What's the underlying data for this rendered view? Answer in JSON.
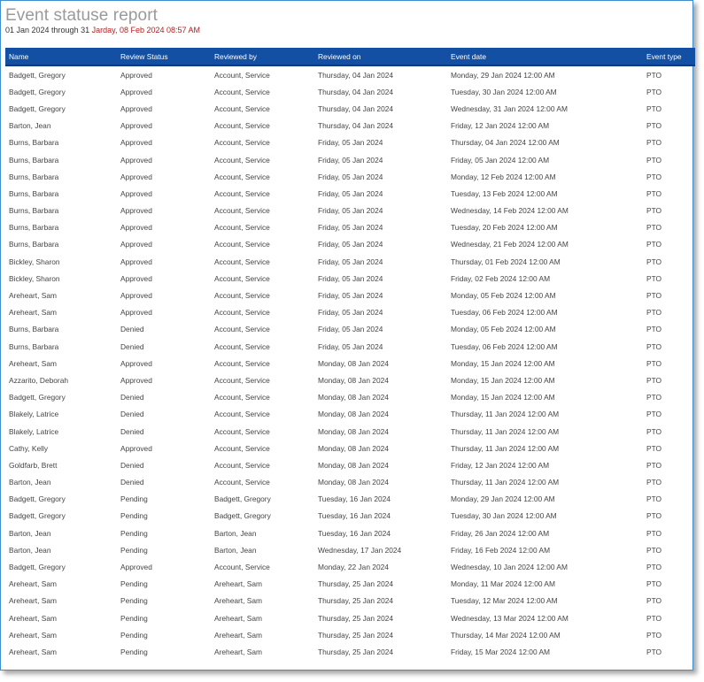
{
  "report": {
    "title": "Event statuse report",
    "range_start": "01 Jan 2024 through 31",
    "range_accent": "Jarday, 08 Feb 2024 08:57 AM"
  },
  "table": {
    "headers": [
      "Name",
      "Review Status",
      "Reviewed by",
      "Reviewed on",
      "Event date",
      "Event type"
    ],
    "rows": [
      [
        "Badgett, Gregory",
        "Approved",
        "Account, Service",
        "Thursday, 04 Jan 2024",
        "Monday, 29 Jan 2024 12:00 AM",
        "PTO"
      ],
      [
        "Badgett, Gregory",
        "Approved",
        "Account, Service",
        "Thursday, 04 Jan 2024",
        "Tuesday, 30 Jan 2024 12:00 AM",
        "PTO"
      ],
      [
        "Badgett, Gregory",
        "Approved",
        "Account, Service",
        "Thursday, 04 Jan 2024",
        "Wednesday, 31 Jan 2024 12:00 AM",
        "PTO"
      ],
      [
        "Barton, Jean",
        "Approved",
        "Account, Service",
        "Thursday, 04 Jan 2024",
        "Friday, 12 Jan 2024 12:00 AM",
        "PTO"
      ],
      [
        "Burns, Barbara",
        "Approved",
        "Account, Service",
        "Friday, 05 Jan 2024",
        "Thursday, 04 Jan 2024 12:00 AM",
        "PTO"
      ],
      [
        "Burns, Barbara",
        "Approved",
        "Account, Service",
        "Friday, 05 Jan 2024",
        "Friday, 05 Jan 2024 12:00 AM",
        "PTO"
      ],
      [
        "Burns, Barbara",
        "Approved",
        "Account, Service",
        "Friday, 05 Jan 2024",
        "Monday, 12 Feb 2024 12:00 AM",
        "PTO"
      ],
      [
        "Burns, Barbara",
        "Approved",
        "Account, Service",
        "Friday, 05 Jan 2024",
        "Tuesday, 13 Feb 2024 12:00 AM",
        "PTO"
      ],
      [
        "Burns, Barbara",
        "Approved",
        "Account, Service",
        "Friday, 05 Jan 2024",
        "Wednesday, 14 Feb 2024 12:00 AM",
        "PTO"
      ],
      [
        "Burns, Barbara",
        "Approved",
        "Account, Service",
        "Friday, 05 Jan 2024",
        "Tuesday, 20 Feb 2024 12:00 AM",
        "PTO"
      ],
      [
        "Burns, Barbara",
        "Approved",
        "Account, Service",
        "Friday, 05 Jan 2024",
        "Wednesday, 21 Feb 2024 12:00 AM",
        "PTO"
      ],
      [
        "Bickley, Sharon",
        "Approved",
        "Account, Service",
        "Friday, 05 Jan 2024",
        "Thursday, 01 Feb 2024 12:00 AM",
        "PTO"
      ],
      [
        "Bickley, Sharon",
        "Approved",
        "Account, Service",
        "Friday, 05 Jan 2024",
        "Friday, 02 Feb 2024 12:00 AM",
        "PTO"
      ],
      [
        "Areheart, Sam",
        "Approved",
        "Account, Service",
        "Friday, 05 Jan 2024",
        "Monday, 05 Feb 2024 12:00 AM",
        "PTO"
      ],
      [
        "Areheart, Sam",
        "Approved",
        "Account, Service",
        "Friday, 05 Jan 2024",
        "Tuesday, 06 Feb 2024 12:00 AM",
        "PTO"
      ],
      [
        "Burns, Barbara",
        "Denied",
        "Account, Service",
        "Friday, 05 Jan 2024",
        "Monday, 05 Feb 2024 12:00 AM",
        "PTO"
      ],
      [
        "Burns, Barbara",
        "Denied",
        "Account, Service",
        "Friday, 05 Jan 2024",
        "Tuesday, 06 Feb 2024 12:00 AM",
        "PTO"
      ],
      [
        "Areheart, Sam",
        "Approved",
        "Account, Service",
        "Monday, 08 Jan 2024",
        "Monday, 15 Jan 2024 12:00 AM",
        "PTO"
      ],
      [
        "Azzarito, Deborah",
        "Approved",
        "Account, Service",
        "Monday, 08 Jan 2024",
        "Monday, 15 Jan 2024 12:00 AM",
        "PTO"
      ],
      [
        "Badgett, Gregory",
        "Denied",
        "Account, Service",
        "Monday, 08 Jan 2024",
        "Monday, 15 Jan 2024 12:00 AM",
        "PTO"
      ],
      [
        "Blakely, Latrice",
        "Denied",
        "Account, Service",
        "Monday, 08 Jan 2024",
        "Thursday, 11 Jan 2024 12:00 AM",
        "PTO"
      ],
      [
        "Blakely, Latrice",
        "Denied",
        "Account, Service",
        "Monday, 08 Jan 2024",
        "Thursday, 11 Jan 2024 12:00 AM",
        "PTO"
      ],
      [
        "Cathy, Kelly",
        "Approved",
        "Account, Service",
        "Monday, 08 Jan 2024",
        "Thursday, 11 Jan 2024 12:00 AM",
        "PTO"
      ],
      [
        "Goldfarb, Brett",
        "Denied",
        "Account, Service",
        "Monday, 08 Jan 2024",
        "Friday, 12 Jan 2024 12:00 AM",
        "PTO"
      ],
      [
        "Barton, Jean",
        "Denied",
        "Account, Service",
        "Monday, 08 Jan 2024",
        "Thursday, 11 Jan 2024 12:00 AM",
        "PTO"
      ],
      [
        "Badgett, Gregory",
        "Pending",
        "Badgett, Gregory",
        "Tuesday, 16 Jan 2024",
        "Monday, 29 Jan 2024 12:00 AM",
        "PTO"
      ],
      [
        "Badgett, Gregory",
        "Pending",
        "Badgett, Gregory",
        "Tuesday, 16 Jan 2024",
        "Tuesday, 30 Jan 2024 12:00 AM",
        "PTO"
      ],
      [
        "Barton, Jean",
        "Pending",
        "Barton, Jean",
        "Tuesday, 16 Jan 2024",
        "Friday, 26 Jan 2024 12:00 AM",
        "PTO"
      ],
      [
        "Barton, Jean",
        "Pending",
        "Barton, Jean",
        "Wednesday, 17 Jan 2024",
        "Friday, 16 Feb 2024 12:00 AM",
        "PTO"
      ],
      [
        "Badgett, Gregory",
        "Approved",
        "Account, Service",
        "Monday, 22 Jan 2024",
        "Wednesday, 10 Jan 2024 12:00 AM",
        "PTO"
      ],
      [
        "Areheart, Sam",
        "Pending",
        "Areheart, Sam",
        "Thursday, 25 Jan 2024",
        "Monday, 11 Mar 2024 12:00 AM",
        "PTO"
      ],
      [
        "Areheart, Sam",
        "Pending",
        "Areheart, Sam",
        "Thursday, 25 Jan 2024",
        "Tuesday, 12 Mar 2024 12:00 AM",
        "PTO"
      ],
      [
        "Areheart, Sam",
        "Pending",
        "Areheart, Sam",
        "Thursday, 25 Jan 2024",
        "Wednesday, 13 Mar 2024 12:00 AM",
        "PTO"
      ],
      [
        "Areheart, Sam",
        "Pending",
        "Areheart, Sam",
        "Thursday, 25 Jan 2024",
        "Thursday, 14 Mar 2024 12:00 AM",
        "PTO"
      ],
      [
        "Areheart, Sam",
        "Pending",
        "Areheart, Sam",
        "Thursday, 25 Jan 2024",
        "Friday, 15 Mar 2024 12:00 AM",
        "PTO"
      ]
    ]
  },
  "colors": {
    "header_bg": "#1350a4",
    "accent_text": "#b02020",
    "frame_border": "#3e8fd0"
  }
}
